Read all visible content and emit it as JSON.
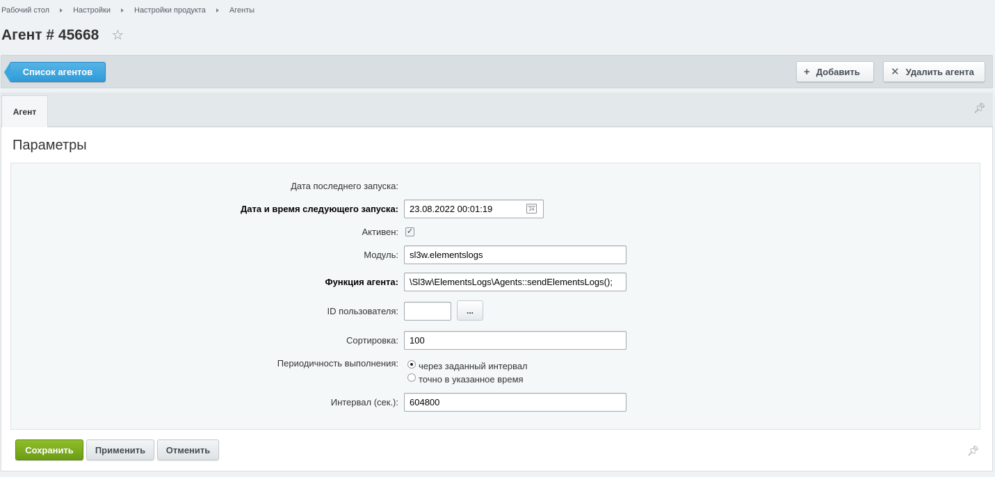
{
  "breadcrumb": [
    "Рабочий стол",
    "Настройки",
    "Настройки продукта",
    "Агенты"
  ],
  "page_title": "Агент # 45668",
  "toolbar": {
    "back_label": "Список агентов",
    "add_label": "Добавить",
    "delete_label": "Удалить агента"
  },
  "tabs": [
    {
      "label": "Агент",
      "active": true
    }
  ],
  "section_title": "Параметры",
  "form": {
    "last_run_label": "Дата последнего запуска:",
    "next_run_label": "Дата и время следующего запуска:",
    "next_run_value": "23.08.2022 00:01:19",
    "calendar_day": "24",
    "active_label": "Активен:",
    "active_checked": true,
    "module_label": "Модуль:",
    "module_value": "sl3w.elementslogs",
    "function_label": "Функция агента:",
    "function_value": "\\Sl3w\\ElementsLogs\\Agents::sendElementsLogs();",
    "user_id_label": "ID пользователя:",
    "user_id_value": "",
    "user_picker_label": "...",
    "sort_label": "Сортировка:",
    "sort_value": "100",
    "periodicity_label": "Периодичность выполнения:",
    "periodicity_options": [
      "через заданный интервал",
      "точно в указанное время"
    ],
    "periodicity_selected": 0,
    "interval_label": "Интервал (сек.):",
    "interval_value": "604800"
  },
  "footer": {
    "save_label": "Сохранить",
    "apply_label": "Применить",
    "cancel_label": "Отменить"
  },
  "colors": {
    "accent_blue": "#2f9bd8",
    "save_green": "#6c9c14",
    "background": "#eef2f4"
  }
}
